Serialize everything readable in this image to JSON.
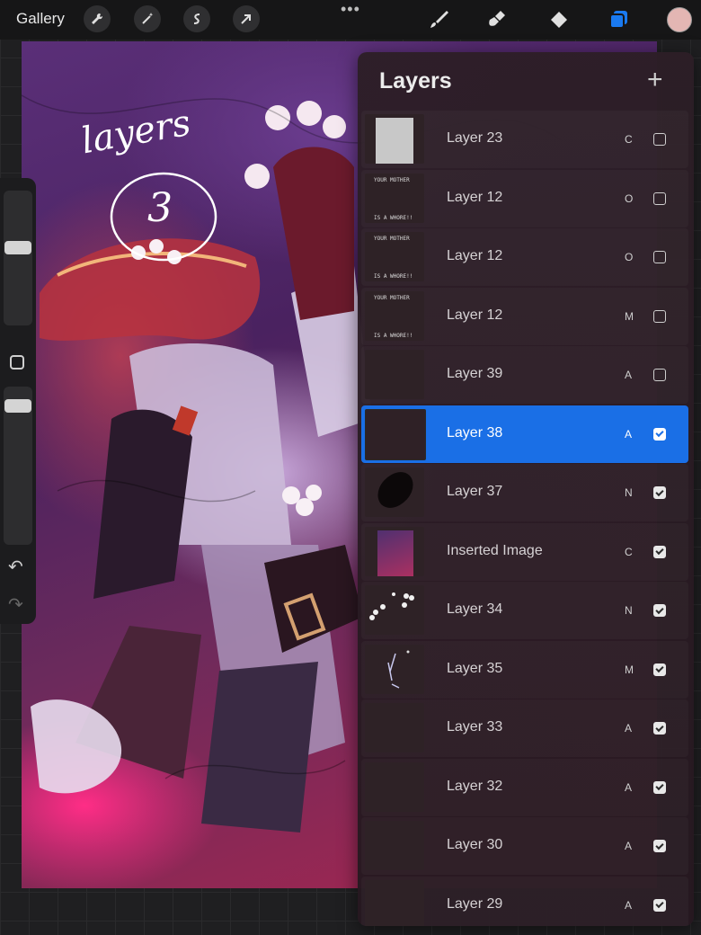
{
  "toolbar": {
    "gallery_label": "Gallery",
    "left_icons": [
      "wrench-icon",
      "magic-wand-icon",
      "selection-icon",
      "transform-arrow-icon"
    ],
    "more_dots": "•••",
    "right_icons": [
      "brush-icon",
      "smudge-icon",
      "eraser-icon",
      "layers-icon"
    ],
    "color_swatch": "#e3b6b3",
    "active_color": "#1a7af0"
  },
  "canvas": {
    "handwriting_line1": "layers",
    "handwriting_line2": "3"
  },
  "sidebar": {
    "undo_glyph": "↶",
    "redo_glyph": "↷"
  },
  "layers_panel": {
    "title": "Layers",
    "add_glyph": "+",
    "selected_color": "#1a6fe6",
    "layers": [
      {
        "name": "Layer 23",
        "blend": "C",
        "visible": false,
        "thumb": "white"
      },
      {
        "name": "Layer 12",
        "blend": "O",
        "visible": false,
        "thumb": "text",
        "thumb_text_top": "YOUR MOTHER",
        "thumb_text_bottom": "IS A WHORE!!"
      },
      {
        "name": "Layer 12",
        "blend": "O",
        "visible": false,
        "thumb": "text",
        "thumb_text_top": "YOUR MOTHER",
        "thumb_text_bottom": "IS A WHORE!!"
      },
      {
        "name": "Layer 12",
        "blend": "M",
        "visible": false,
        "thumb": "text",
        "thumb_text_top": "YOUR MOTHER",
        "thumb_text_bottom": "IS A WHORE!!"
      },
      {
        "name": "Layer 39",
        "blend": "A",
        "visible": false,
        "thumb": "blank"
      },
      {
        "name": "Layer 38",
        "blend": "A",
        "visible": true,
        "thumb": "blank",
        "selected": true
      },
      {
        "name": "Layer 37",
        "blend": "N",
        "visible": true,
        "thumb": "blob"
      },
      {
        "name": "Inserted Image",
        "blend": "C",
        "visible": true,
        "thumb": "image"
      },
      {
        "name": "Layer 34",
        "blend": "N",
        "visible": true,
        "thumb": "spots"
      },
      {
        "name": "Layer 35",
        "blend": "M",
        "visible": true,
        "thumb": "lines"
      },
      {
        "name": "Layer 33",
        "blend": "A",
        "visible": true,
        "thumb": "blank"
      },
      {
        "name": "Layer 32",
        "blend": "A",
        "visible": true,
        "thumb": "blank"
      },
      {
        "name": "Layer 30",
        "blend": "A",
        "visible": true,
        "thumb": "blank"
      },
      {
        "name": "Layer 29",
        "blend": "A",
        "visible": true,
        "thumb": "blank"
      }
    ]
  }
}
